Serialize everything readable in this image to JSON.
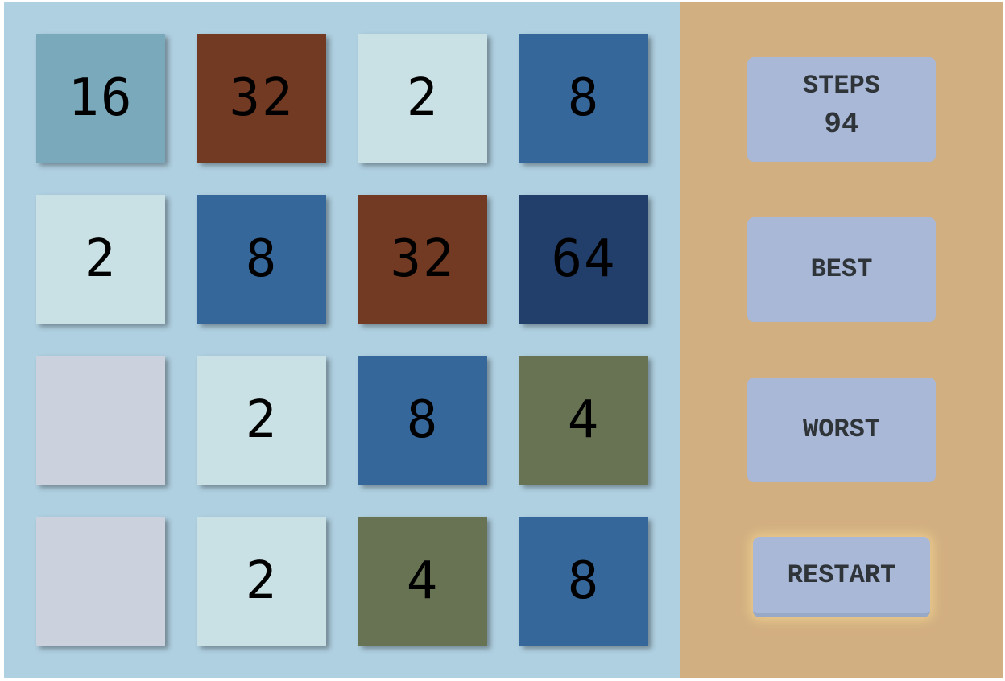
{
  "board": {
    "tiles": [
      {
        "value": "16",
        "color": "#7aa9bc"
      },
      {
        "value": "32",
        "color": "#723a22"
      },
      {
        "value": "2",
        "color": "#c9e1e4"
      },
      {
        "value": "8",
        "color": "#36679a"
      },
      {
        "value": "2",
        "color": "#c9e1e4"
      },
      {
        "value": "8",
        "color": "#36679a"
      },
      {
        "value": "32",
        "color": "#723a22"
      },
      {
        "value": "64",
        "color": "#223e6a"
      },
      {
        "value": "",
        "color": "#ccd1de"
      },
      {
        "value": "2",
        "color": "#c9e1e4"
      },
      {
        "value": "8",
        "color": "#36679a"
      },
      {
        "value": "4",
        "color": "#677353"
      },
      {
        "value": "",
        "color": "#ccd1de"
      },
      {
        "value": "2",
        "color": "#c9e1e4"
      },
      {
        "value": "4",
        "color": "#677353"
      },
      {
        "value": "8",
        "color": "#36679a"
      }
    ]
  },
  "sidebar": {
    "steps_label": "STEPS",
    "steps_value": "94",
    "best_label": "BEST",
    "worst_label": "WORST",
    "restart_label": "RESTART"
  },
  "colors": {
    "board_background": "#afd0e1",
    "sidebar_background": "#d2af81",
    "panel_background": "#a9b8d7"
  }
}
